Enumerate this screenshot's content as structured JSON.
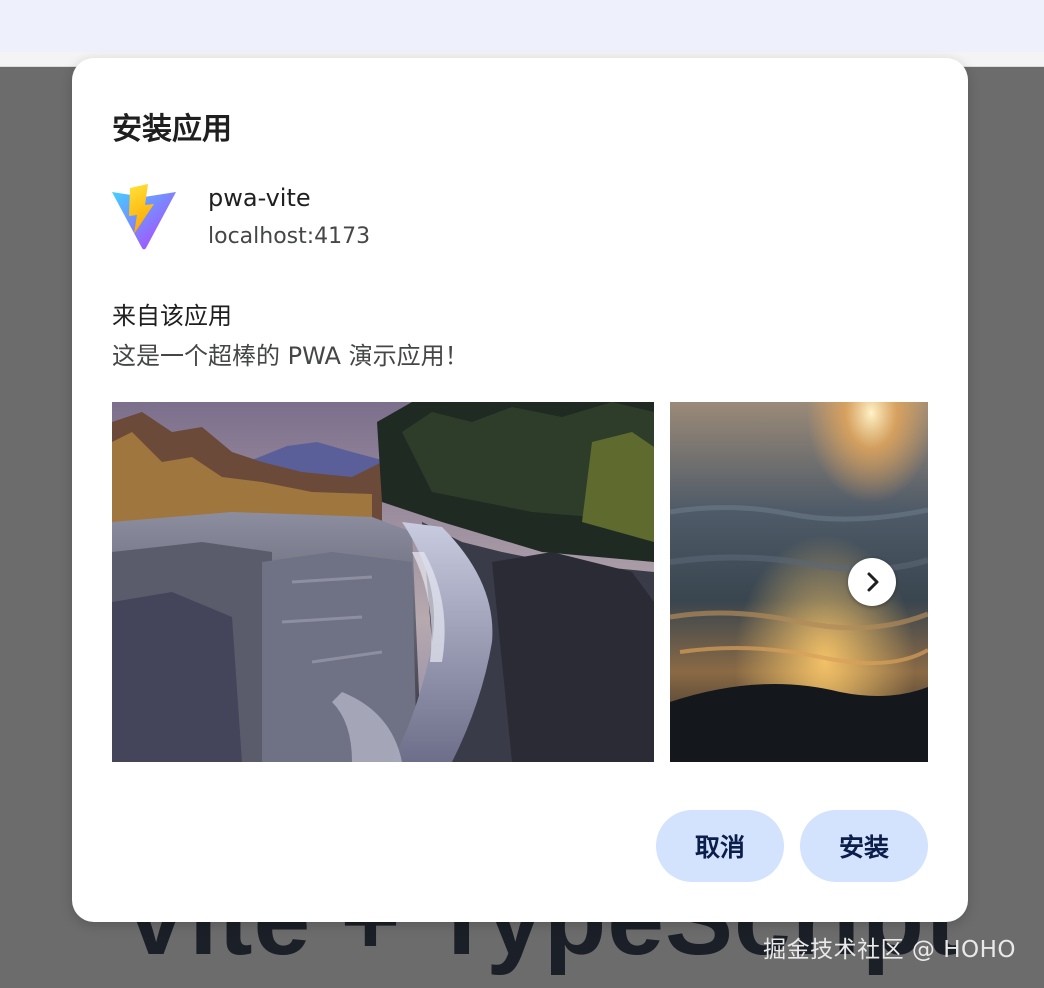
{
  "background_page": {
    "heading": "Vite + TypeScript",
    "watermark": "掘金技术社区 @ HOHO"
  },
  "install_dialog": {
    "title": "安装应用",
    "app": {
      "icon": "vite-logo-icon",
      "name": "pwa-vite",
      "origin": "localhost:4173"
    },
    "section_heading": "来自该应用",
    "description": "这是一个超棒的 PWA 演示应用！",
    "screenshots": [
      {
        "icon": "screenshot-river-canyon"
      },
      {
        "icon": "screenshot-sunset-water"
      }
    ],
    "next_icon": "chevron-right-icon",
    "buttons": {
      "cancel": "取消",
      "install": "安装"
    }
  },
  "colors": {
    "overlay": "#6c6c6c",
    "dialog_bg": "#ffffff",
    "button_bg": "#d3e2fd",
    "button_text": "#0b1d4a",
    "browser_chrome": "#eef1fb"
  }
}
